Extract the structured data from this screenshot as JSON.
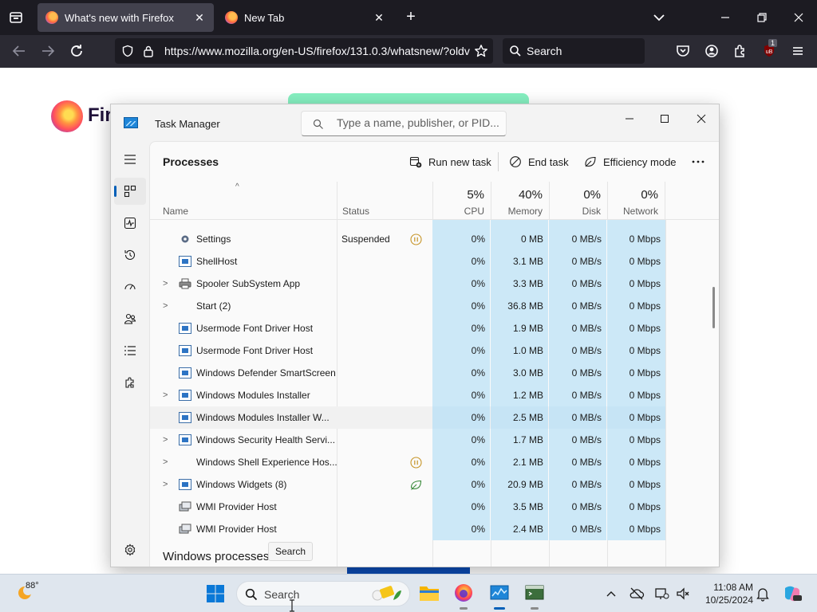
{
  "browser": {
    "tabs": [
      {
        "title": "What's new with Firefox",
        "active": true
      },
      {
        "title": "New Tab",
        "active": false
      }
    ],
    "url": "https://www.mozilla.org/en-US/firefox/131.0.3/whatsnew/?oldv",
    "search_placeholder": "Search",
    "extension_badge": "1"
  },
  "page": {
    "logo_word": "Fir"
  },
  "task_manager": {
    "title": "Task Manager",
    "search_placeholder": "Type a name, publisher, or PID...",
    "page_title": "Processes",
    "commands": {
      "run_new_task": "Run new task",
      "end_task": "End task",
      "efficiency_mode": "Efficiency mode"
    },
    "columns": {
      "name": "Name",
      "status": "Status",
      "cpu": {
        "pct": "5%",
        "label": "CPU"
      },
      "memory": {
        "pct": "40%",
        "label": "Memory"
      },
      "disk": {
        "pct": "0%",
        "label": "Disk"
      },
      "network": {
        "pct": "0%",
        "label": "Network"
      }
    },
    "rows": [
      {
        "name": "Settings",
        "status": "Suspended",
        "status_icon": "pause-icon",
        "cpu": "0%",
        "memory": "0 MB",
        "disk": "0 MB/s",
        "network": "0 Mbps"
      },
      {
        "name": "ShellHost",
        "status": "",
        "status_icon": "",
        "cpu": "0%",
        "memory": "3.1 MB",
        "disk": "0 MB/s",
        "network": "0 Mbps"
      },
      {
        "name": "Spooler SubSystem App",
        "status": "",
        "status_icon": "",
        "cpu": "0%",
        "memory": "3.3 MB",
        "disk": "0 MB/s",
        "network": "0 Mbps"
      },
      {
        "name": "Start (2)",
        "status": "",
        "status_icon": "",
        "cpu": "0%",
        "memory": "36.8 MB",
        "disk": "0 MB/s",
        "network": "0 Mbps"
      },
      {
        "name": "Usermode Font Driver Host",
        "status": "",
        "status_icon": "",
        "cpu": "0%",
        "memory": "1.9 MB",
        "disk": "0 MB/s",
        "network": "0 Mbps"
      },
      {
        "name": "Usermode Font Driver Host",
        "status": "",
        "status_icon": "",
        "cpu": "0%",
        "memory": "1.0 MB",
        "disk": "0 MB/s",
        "network": "0 Mbps"
      },
      {
        "name": "Windows Defender SmartScreen",
        "status": "",
        "status_icon": "",
        "cpu": "0%",
        "memory": "3.0 MB",
        "disk": "0 MB/s",
        "network": "0 Mbps"
      },
      {
        "name": "Windows Modules Installer",
        "status": "",
        "status_icon": "",
        "cpu": "0%",
        "memory": "1.2 MB",
        "disk": "0 MB/s",
        "network": "0 Mbps"
      },
      {
        "name": "Windows Modules Installer W...",
        "status": "",
        "status_icon": "",
        "cpu": "0%",
        "memory": "2.5 MB",
        "disk": "0 MB/s",
        "network": "0 Mbps"
      },
      {
        "name": "Windows Security Health Servi...",
        "status": "",
        "status_icon": "",
        "cpu": "0%",
        "memory": "1.7 MB",
        "disk": "0 MB/s",
        "network": "0 Mbps"
      },
      {
        "name": "Windows Shell Experience Hos...",
        "status": "",
        "status_icon": "pause-icon",
        "cpu": "0%",
        "memory": "2.1 MB",
        "disk": "0 MB/s",
        "network": "0 Mbps"
      },
      {
        "name": "Windows Widgets (8)",
        "status": "",
        "status_icon": "efficiency-leaf-icon",
        "cpu": "0%",
        "memory": "20.9 MB",
        "disk": "0 MB/s",
        "network": "0 Mbps"
      },
      {
        "name": "WMI Provider Host",
        "status": "",
        "status_icon": "",
        "cpu": "0%",
        "memory": "3.5 MB",
        "disk": "0 MB/s",
        "network": "0 Mbps"
      },
      {
        "name": "WMI Provider Host",
        "status": "",
        "status_icon": "",
        "cpu": "0%",
        "memory": "2.4 MB",
        "disk": "0 MB/s",
        "network": "0 Mbps"
      }
    ],
    "section_title": "Windows processes",
    "tooltip": "Search"
  },
  "taskbar": {
    "weather_temp": "88°",
    "search_placeholder": "Search",
    "time": "11:08 AM",
    "date": "10/25/2024"
  },
  "colors": {
    "accent": "#005fb8",
    "heat": "#cce8f7",
    "suspended": "#c69426",
    "efficiency": "#3a8a3a"
  }
}
